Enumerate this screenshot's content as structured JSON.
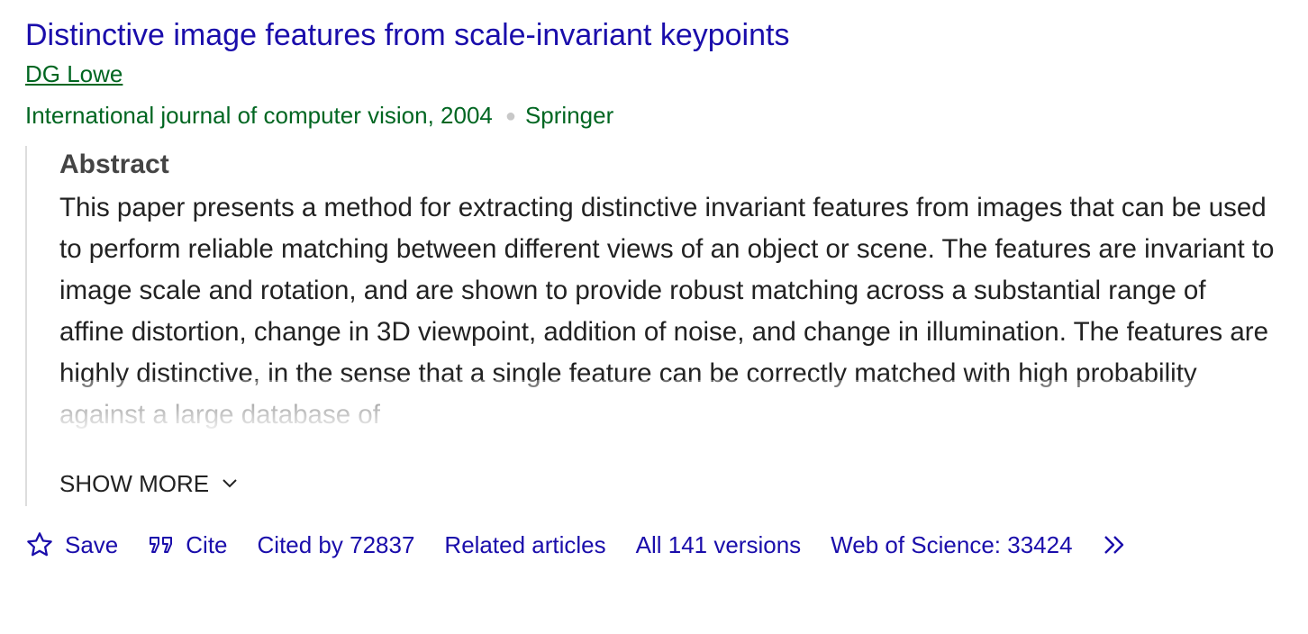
{
  "result": {
    "title": "Distinctive image features from scale-invariant keypoints",
    "author": "DG Lowe",
    "venue": "International journal of computer vision, 2004",
    "publisher": "Springer"
  },
  "abstract": {
    "heading": "Abstract",
    "text": "This paper presents a method for extracting distinctive invariant features from images that can be used to perform reliable matching between different views of an object or scene. The features are invariant to image scale and rotation, and are shown to provide robust matching across a substantial range of affine distortion, change in 3D viewpoint, addition of noise, and change in illumination. The features are highly distinctive, in the sense that a single feature can be correctly matched with high probability against a large database of",
    "show_more_label": "SHOW MORE"
  },
  "actions": {
    "save_label": "Save",
    "cite_label": "Cite",
    "cited_by_label": "Cited by 72837",
    "related_label": "Related articles",
    "versions_label": "All 141 versions",
    "wos_label": "Web of Science: 33424"
  },
  "icons": {
    "save": "star-icon",
    "cite": "quote-icon",
    "show_more": "chevron-down-icon",
    "more": "double-chevron-right-icon"
  },
  "colors": {
    "link": "#1a0dab",
    "green": "#006621",
    "text": "#222222",
    "heading": "#444444"
  }
}
